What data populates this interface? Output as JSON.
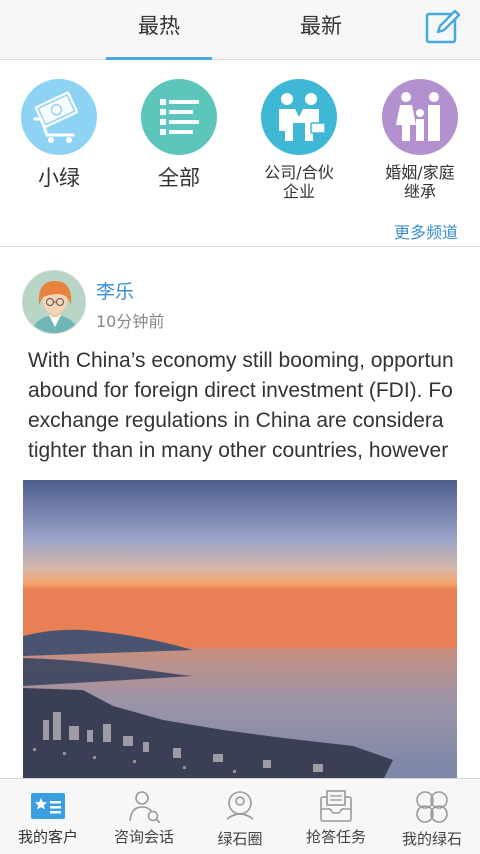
{
  "tabs": [
    {
      "label": "最热"
    },
    {
      "label": "最新"
    }
  ],
  "channels": [
    {
      "label": "小绿",
      "icon": "money-cart-icon",
      "color": "#8fd3f4"
    },
    {
      "label": "全部",
      "icon": "list-icon",
      "color": "#5cc6bc"
    },
    {
      "label_line1": "公司/合伙",
      "label_line2": "企业",
      "icon": "handshake-icon",
      "color": "#3fb8d6"
    },
    {
      "label_line1": "婚姻/家庭",
      "label_line2": "继承",
      "icon": "family-icon",
      "color": "#b391cf"
    }
  ],
  "more_channels": "更多频道",
  "post": {
    "author": "李乐",
    "time": "10分钟前",
    "lines": [
      "With China’s economy still booming, opportun",
      "abound for foreign direct investment (FDI). Fo",
      "exchange regulations in China are considera",
      "tighter than in many other countries, however"
    ]
  },
  "bottom_nav": [
    {
      "label": "我的客户",
      "icon": "customer-card-icon"
    },
    {
      "label": "咨询会话",
      "icon": "consult-person-icon"
    },
    {
      "label": "绿石圈",
      "icon": "circle-community-icon"
    },
    {
      "label": "抢答任务",
      "icon": "task-inbox-icon"
    },
    {
      "label": "我的绿石",
      "icon": "four-petal-icon"
    }
  ],
  "colors": {
    "accent": "#48a8e0",
    "link": "#3a8fd0"
  }
}
